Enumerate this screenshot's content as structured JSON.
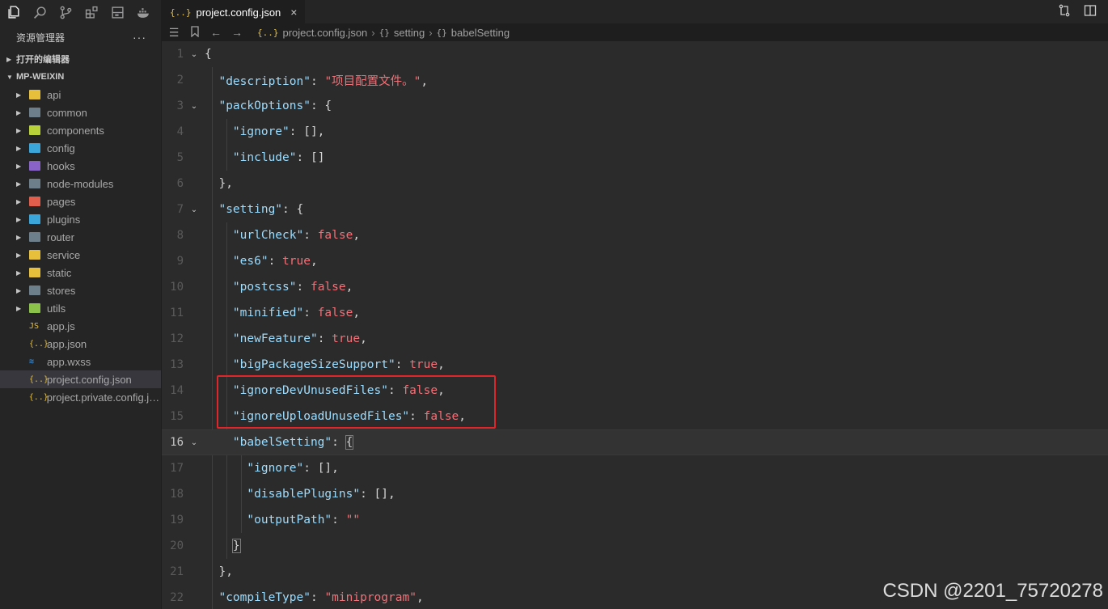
{
  "sidebar": {
    "title": "资源管理器",
    "more": "···",
    "open_editors": "打开的编辑器",
    "project": "MP-WEIXIN",
    "items": [
      {
        "label": "api",
        "type": "folder",
        "color": "#e8bf3a"
      },
      {
        "label": "common",
        "type": "folder",
        "color": "#6d7f8a"
      },
      {
        "label": "components",
        "type": "folder",
        "color": "#b9d23a"
      },
      {
        "label": "config",
        "type": "folder",
        "color": "#3aa6d9"
      },
      {
        "label": "hooks",
        "type": "folder",
        "color": "#8a63c9"
      },
      {
        "label": "node-modules",
        "type": "folder",
        "color": "#6d7f8a"
      },
      {
        "label": "pages",
        "type": "folder",
        "color": "#e05e4b"
      },
      {
        "label": "plugins",
        "type": "folder",
        "color": "#3aa6d9"
      },
      {
        "label": "router",
        "type": "folder",
        "color": "#6d7f8a"
      },
      {
        "label": "service",
        "type": "folder",
        "color": "#e8bf3a"
      },
      {
        "label": "static",
        "type": "folder",
        "color": "#e8bf3a"
      },
      {
        "label": "stores",
        "type": "folder",
        "color": "#6d7f8a"
      },
      {
        "label": "utils",
        "type": "folder",
        "color": "#8bc34a"
      },
      {
        "label": "app.js",
        "type": "file",
        "icon": "JS"
      },
      {
        "label": "app.json",
        "type": "file",
        "icon": "{..}"
      },
      {
        "label": "app.wxss",
        "type": "file",
        "icon": "≋"
      },
      {
        "label": "project.config.json",
        "type": "file",
        "icon": "{..}",
        "selected": true
      },
      {
        "label": "project.private.config.js...",
        "type": "file",
        "icon": "{..}"
      }
    ]
  },
  "tab": {
    "icon": "{..}",
    "label": "project.config.json",
    "close": "×"
  },
  "breadcrumb": {
    "file_icon": "{..}",
    "file": "project.config.json",
    "sep": "›",
    "obj_icon": "{}",
    "item1": "setting",
    "item2": "babelSetting"
  },
  "editor": {
    "current_line": 16,
    "lines": [
      {
        "n": "1"
      },
      {
        "n": "2"
      },
      {
        "n": "3"
      },
      {
        "n": "4"
      },
      {
        "n": "5"
      },
      {
        "n": "6"
      },
      {
        "n": "7"
      },
      {
        "n": "8"
      },
      {
        "n": "9"
      },
      {
        "n": "10"
      },
      {
        "n": "11"
      },
      {
        "n": "12"
      },
      {
        "n": "13"
      },
      {
        "n": "14"
      },
      {
        "n": "15"
      },
      {
        "n": "16"
      },
      {
        "n": "17"
      },
      {
        "n": "18"
      },
      {
        "n": "19"
      },
      {
        "n": "20"
      },
      {
        "n": "21"
      },
      {
        "n": "22"
      }
    ],
    "tokens": {
      "l1": "{",
      "l2k": "\"description\"",
      "l2v": "\"项目配置文件。\"",
      "l3k": "\"packOptions\"",
      "l4k": "\"ignore\"",
      "l5k": "\"include\"",
      "l7k": "\"setting\"",
      "l8k": "\"urlCheck\"",
      "l8v": "false",
      "l9k": "\"es6\"",
      "l9v": "true",
      "l10k": "\"postcss\"",
      "l10v": "false",
      "l11k": "\"minified\"",
      "l11v": "false",
      "l12k": "\"newFeature\"",
      "l12v": "true",
      "l13k": "\"bigPackageSizeSupport\"",
      "l13v": "true",
      "l14k": "\"ignoreDevUnusedFiles\"",
      "l14v": "false",
      "l15k": "\"ignoreUploadUnusedFiles\"",
      "l15v": "false",
      "l16k": "\"babelSetting\"",
      "l17k": "\"ignore\"",
      "l18k": "\"disablePlugins\"",
      "l19k": "\"outputPath\"",
      "l19v": "\"\"",
      "l22k": "\"compileType\"",
      "l22v": "\"miniprogram\""
    }
  },
  "watermark": "CSDN @2201_75720278",
  "colors": {
    "highlight_box": "#e0262a",
    "key": "#9cdcfe",
    "value": "#f07178"
  }
}
